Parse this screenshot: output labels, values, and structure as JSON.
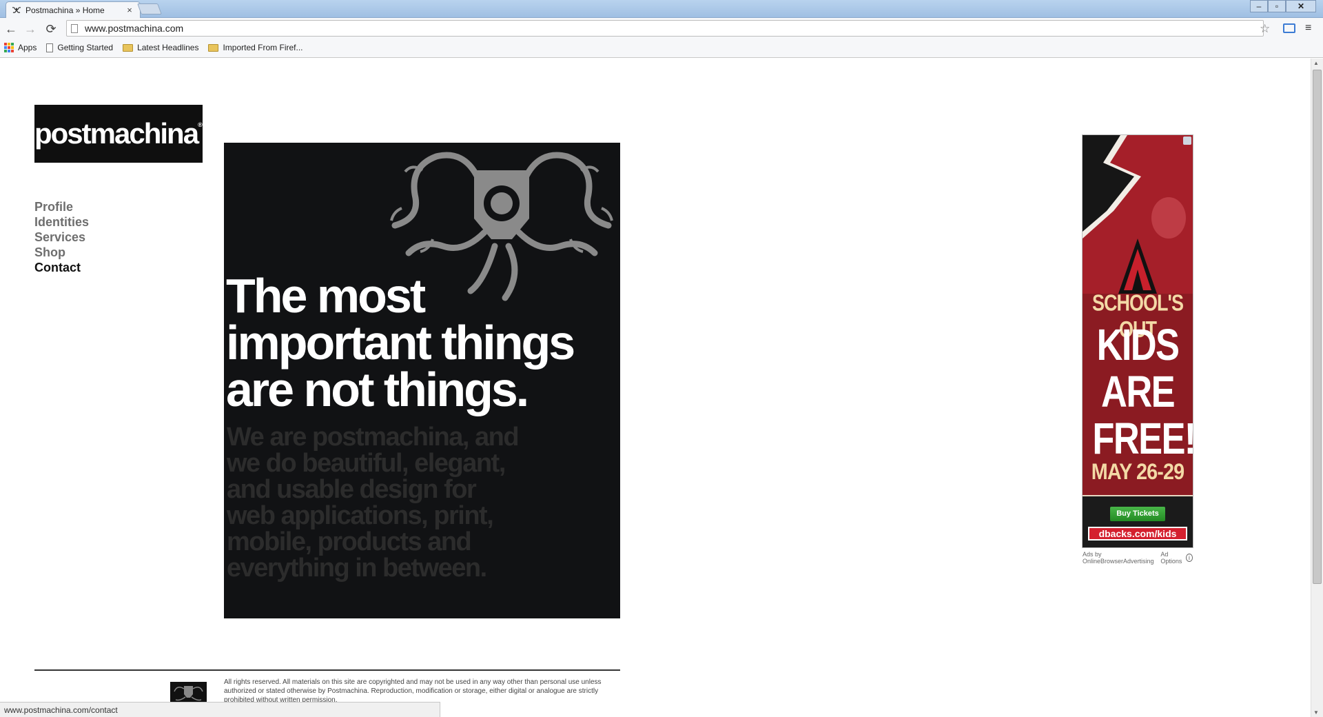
{
  "browser": {
    "tab_title": "Postmachina » Home",
    "tab_close": "×",
    "url": "www.postmachina.com",
    "back_icon": "←",
    "forward_icon": "→",
    "reload_icon": "⟳",
    "star_icon": "☆",
    "menu_icon": "≡",
    "window_min": "–",
    "window_max": "▫",
    "window_close": "✕",
    "bookmarks": [
      {
        "label": "Apps",
        "icon": "apps-grid-icon"
      },
      {
        "label": "Getting Started",
        "icon": "page-icon"
      },
      {
        "label": "Latest Headlines",
        "icon": "folder-icon"
      },
      {
        "label": "Imported From Firef...",
        "icon": "folder-icon"
      }
    ],
    "status_url": "www.postmachina.com/contact",
    "colors": {
      "title_bar": "#b9d3ee",
      "toolbar": "#f6f7f9"
    }
  },
  "site": {
    "logo_text": "postmachina",
    "logo_mark": "®",
    "nav": [
      "Profile",
      "Identities",
      "Services",
      "Shop",
      "Contact"
    ],
    "active_nav": "Contact",
    "hero_headline": "The most important things are not things.",
    "hero_sub": "We are postmachina, and we do beautiful, elegant, and usable design for web applications, print, mobile, products and everything in between.",
    "footer_text": "All rights reserved. All materials on this site are copyrighted and may not be used in any way other than personal use unless authorized or stated otherwise by Postmachina. Reproduction, modification or storage, either digital or analogue are strictly prohibited without written permission.",
    "colors": {
      "hero_bg": "#111214",
      "nav_text": "#6e6e6e",
      "nav_active": "#111111"
    }
  },
  "ad": {
    "line1": "SCHOOL'S OUT",
    "big_line1": "KIDS",
    "big_line2": "ARE",
    "big_line3": "FREE!",
    "date": "MAY 26-29",
    "button": "Buy Tickets",
    "url": "dbacks.com/kids",
    "credit": "Ads by OnlineBrowserAdvertising",
    "options": "Ad Options",
    "info": "i",
    "colors": {
      "bg": "#8b1b22",
      "button": "#2f9e2f"
    }
  }
}
